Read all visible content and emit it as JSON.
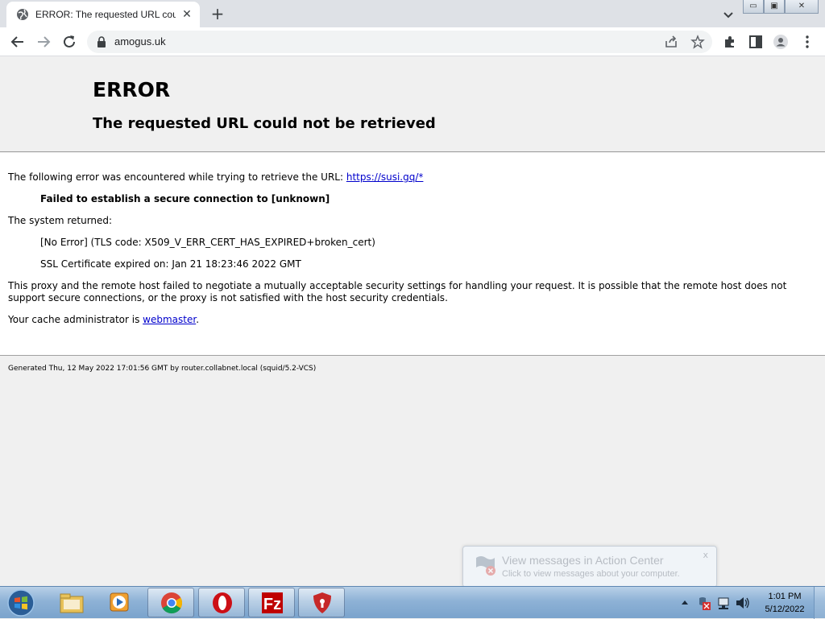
{
  "browser": {
    "tab_title": "ERROR: The requested URL could",
    "tab_close_glyph": "✕",
    "newtab_glyph": "+",
    "url": "amogus.uk",
    "window_controls": [
      "▭",
      "▣",
      "✕"
    ]
  },
  "page": {
    "heading": "ERROR",
    "subheading": "The requested URL could not be retrieved",
    "intro_text": "The following error was encountered while trying to retrieve the URL: ",
    "intro_link": "https://susi.gq/*",
    "failure": "Failed to establish a secure connection to [unknown]",
    "system_returned": "The system returned:",
    "error_code": "[No Error] (TLS code: X509_V_ERR_CERT_HAS_EXPIRED+broken_cert)",
    "cert_expired": "SSL Certificate expired on: Jan 21 18:23:46 2022 GMT",
    "proxy_msg_line1": "This proxy and the remote host failed to negotiate a mutually acceptable security settings for handling your request. It is possible that the remote host does not",
    "proxy_msg_line2": "support secure connections, or the proxy is not satisfied with the host security credentials.",
    "cache_admin_text": "Your cache administrator is ",
    "cache_admin_link": "webmaster",
    "cache_admin_end": ".",
    "footer": "Generated Thu, 12 May 2022 17:01:56 GMT by router.collabnet.local (squid/5.2-VCS)"
  },
  "notification": {
    "title": "View messages in Action Center",
    "subtitle": "Click to view messages about your computer.",
    "close": "x"
  },
  "taskbar": {
    "apps": [
      "file-explorer",
      "media-player",
      "chrome",
      "opera",
      "filezilla",
      "shield-app"
    ],
    "time": "1:01 PM",
    "date": "5/12/2022"
  }
}
